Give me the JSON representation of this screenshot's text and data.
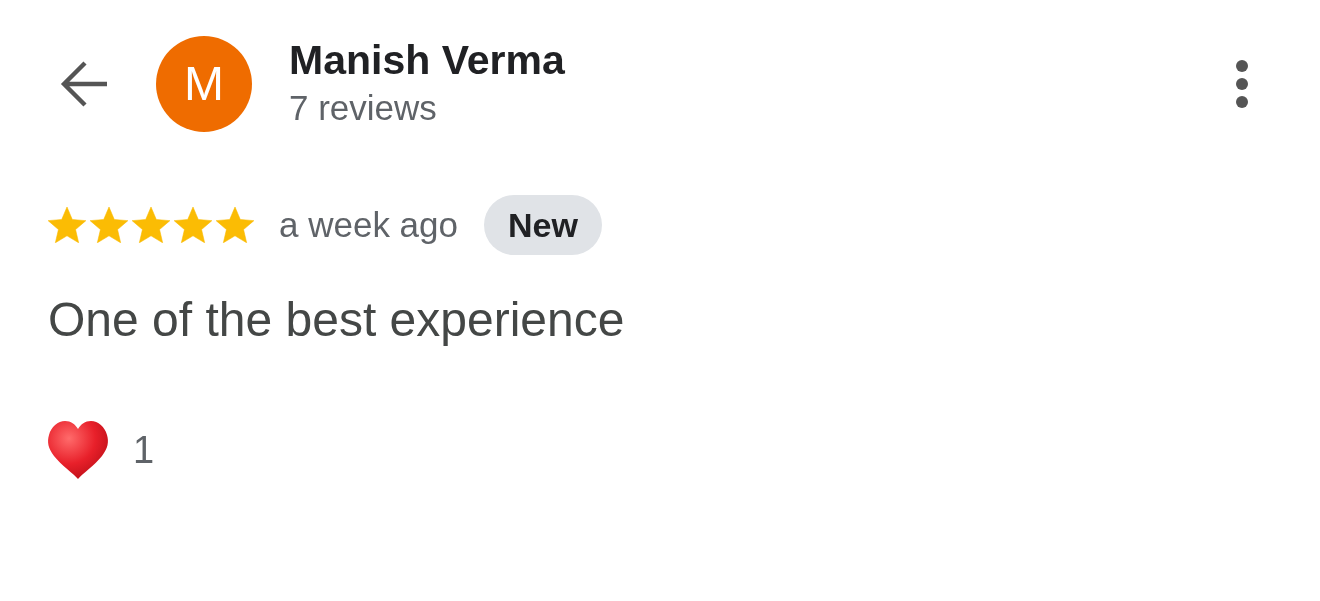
{
  "header": {
    "avatar_initial": "M",
    "name": "Manish Verma",
    "review_count": "7 reviews"
  },
  "review": {
    "stars": 5,
    "time": "a week ago",
    "badge": "New",
    "text": "One of the best experience",
    "reactions": [
      {
        "kind": "heart",
        "count": "1"
      }
    ]
  }
}
